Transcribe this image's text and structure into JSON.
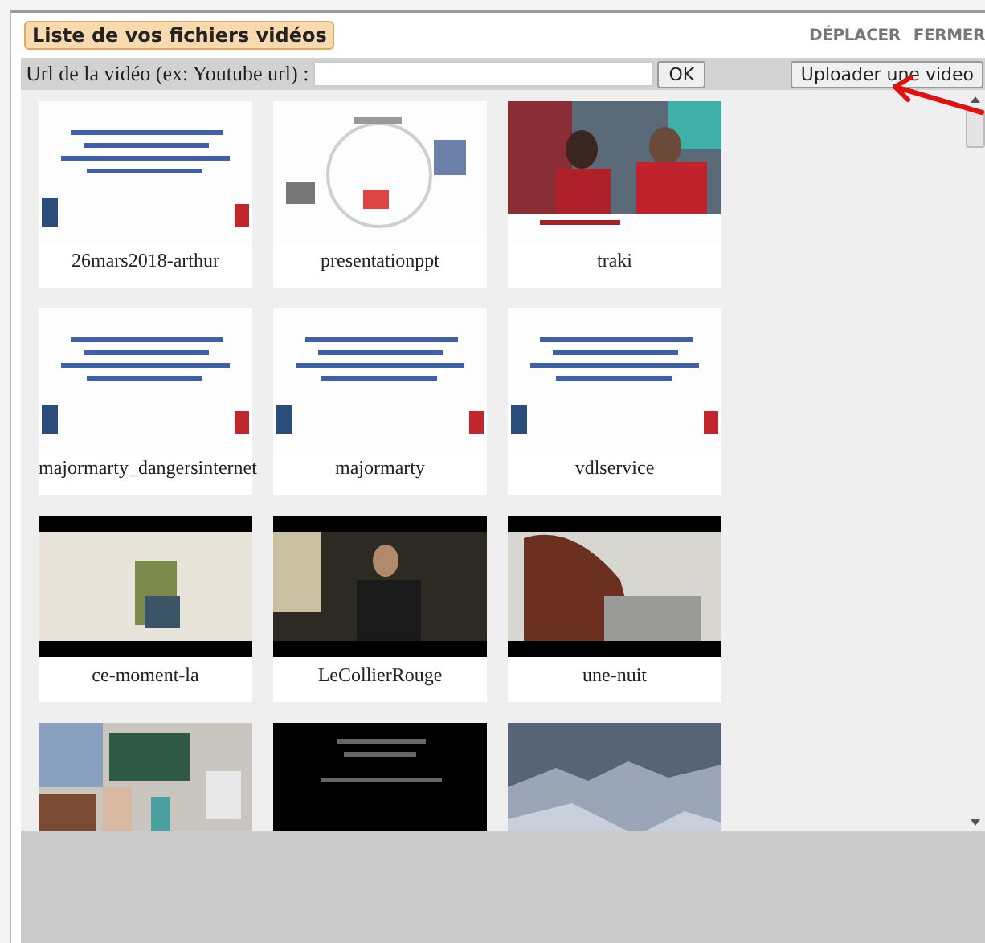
{
  "dialog": {
    "title": "Liste de vos fichiers vidéos",
    "actions": [
      "DÉPLACER",
      "FERMER"
    ]
  },
  "url_bar": {
    "label": "Url de la vidéo (ex: Youtube url) :",
    "ok_button": "OK",
    "upload_button": "Uploader une video"
  },
  "videos": [
    {
      "kind": "picture",
      "title": "26mars2018-arthur"
    },
    {
      "kind": "picture",
      "title": "presentationppt"
    },
    {
      "kind": "picture",
      "title": "traki"
    },
    {
      "kind": "picture",
      "title": "majormarty_dangersinternet"
    },
    {
      "kind": "picture",
      "title": "majormarty"
    },
    {
      "kind": "picture",
      "title": "vdlservice"
    },
    {
      "kind": "picture",
      "title": "ce-moment-la"
    },
    {
      "kind": "picture",
      "title": "LeCollierRouge"
    },
    {
      "kind": "picture",
      "title": "une-nuit"
    },
    {
      "kind": "picture"
    },
    {
      "kind": "picture"
    },
    {
      "kind": "picture"
    }
  ]
}
